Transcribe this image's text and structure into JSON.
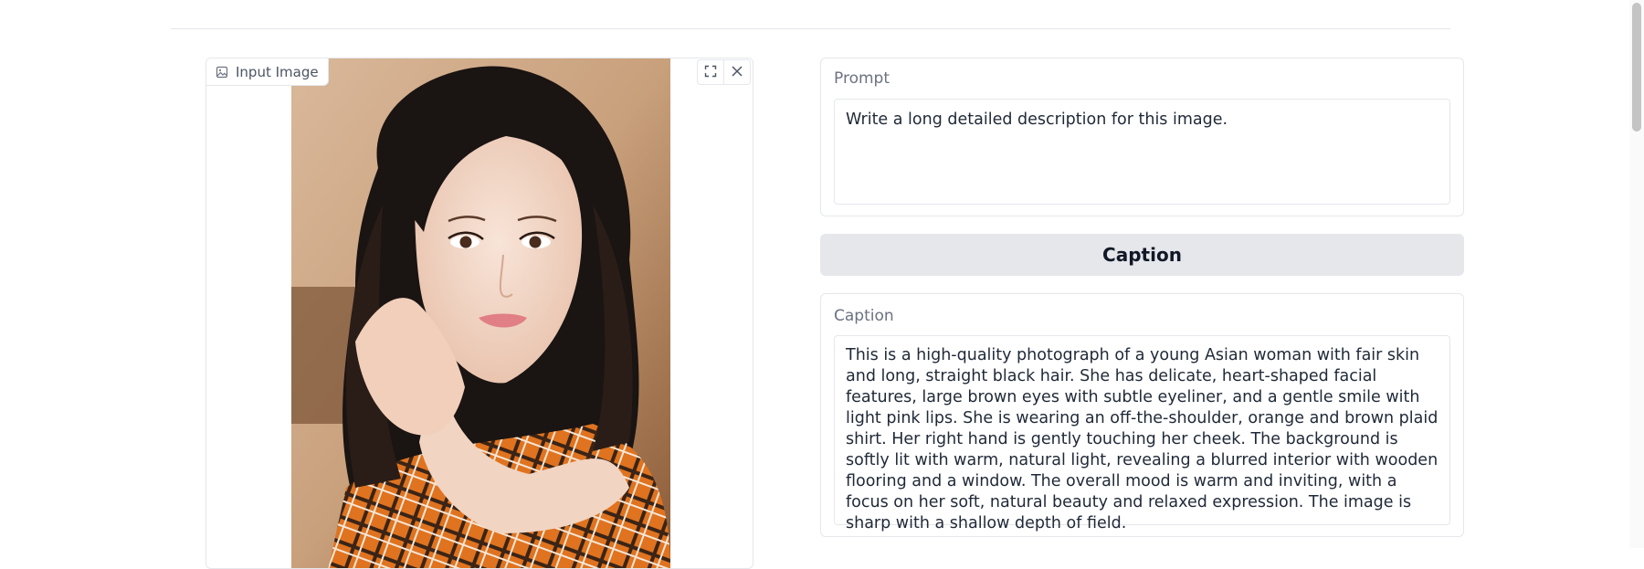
{
  "image_panel": {
    "label": "Input Image"
  },
  "prompt": {
    "label": "Prompt",
    "value": "Write a long detailed description for this image."
  },
  "caption_button": {
    "label": "Caption"
  },
  "caption": {
    "label": "Caption",
    "value": "This is a high-quality photograph of a young Asian woman with fair skin and long, straight black hair. She has delicate, heart-shaped facial features, large brown eyes with subtle eyeliner, and a gentle smile with light pink lips. She is wearing an off-the-shoulder, orange and brown plaid shirt. Her right hand is gently touching her cheek. The background is softly lit with warm, natural light, revealing a blurred interior with wooden flooring and a window. The overall mood is warm and inviting, with a focus on her soft, natural beauty and relaxed expression. The image is sharp with a shallow depth of field."
  },
  "icons": {
    "image_label": "image-icon",
    "fullscreen": "fullscreen-icon",
    "close": "close-icon"
  },
  "colors": {
    "border": "#e5e7eb",
    "button_bg": "#e5e7eb",
    "label": "#6b7280"
  }
}
